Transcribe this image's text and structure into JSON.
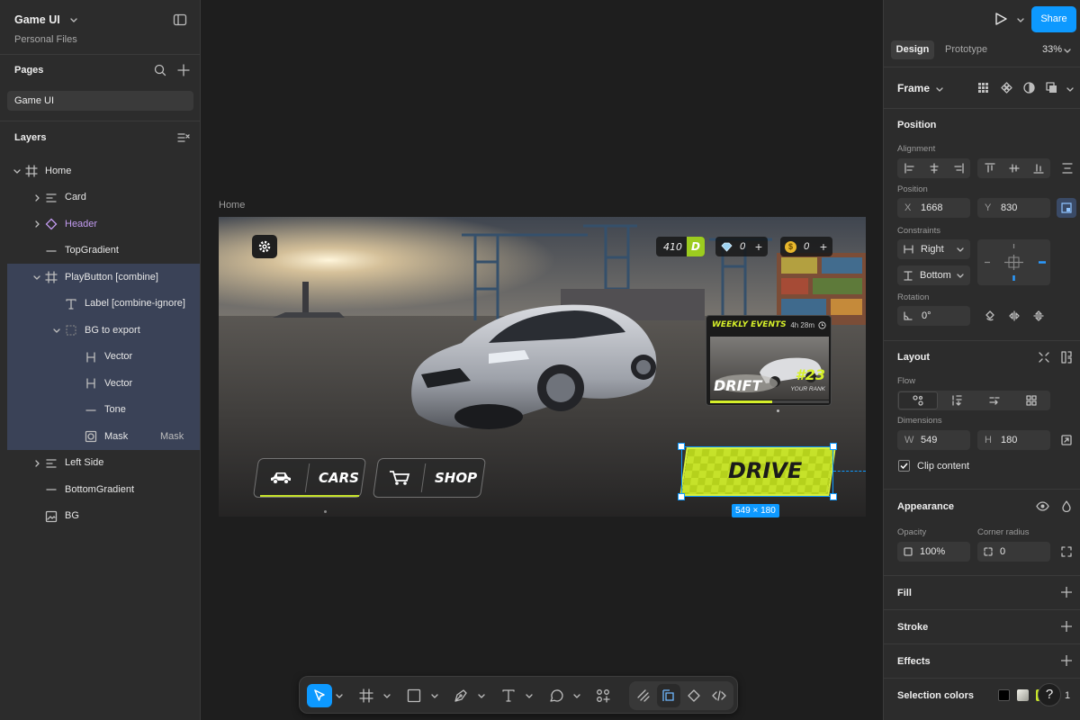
{
  "file": {
    "name": "Game UI",
    "location": "Personal Files"
  },
  "pages": {
    "title": "Pages",
    "items": [
      "Game UI"
    ]
  },
  "layers": {
    "title": "Layers",
    "items": [
      {
        "label": "Home",
        "depth": 0,
        "icon": "frame-icon"
      },
      {
        "label": "Card",
        "depth": 1,
        "icon": "auto-layout-icon"
      },
      {
        "label": "Header",
        "depth": 1,
        "icon": "component-instance-icon"
      },
      {
        "label": "TopGradient",
        "depth": 1,
        "icon": "rectangle-icon"
      },
      {
        "label": "PlayButton [combine]",
        "depth": 1,
        "icon": "frame-icon"
      },
      {
        "label": "Label [combine-ignore]",
        "depth": 2,
        "icon": "text-icon"
      },
      {
        "label": "BG to export",
        "depth": 2,
        "icon": "group-icon"
      },
      {
        "label": "Vector",
        "depth": 3,
        "icon": "vector-icon"
      },
      {
        "label": "Vector",
        "depth": 3,
        "icon": "vector-icon"
      },
      {
        "label": "Tone",
        "depth": 3,
        "icon": "rectangle-icon"
      },
      {
        "label": "Mask",
        "depth": 3,
        "icon": "mask-icon",
        "badge": "Mask"
      },
      {
        "label": "Left Side",
        "depth": 1,
        "icon": "auto-layout-icon"
      },
      {
        "label": "BottomGradient",
        "depth": 1,
        "icon": "rectangle-icon"
      },
      {
        "label": "BG",
        "depth": 1,
        "icon": "image-icon"
      }
    ]
  },
  "canvas": {
    "frame_label": "Home",
    "selection_size": "549 × 180",
    "game": {
      "trophies": "410",
      "rank_letter": "D",
      "gems": "0",
      "coins": "0",
      "event_title": "WEEKLY EVENTS",
      "event_timer": "4h 28m",
      "event_name": "DRIFT",
      "rank_number": "#23",
      "rank_caption": "YOUR RANK",
      "cars_label": "CARS",
      "shop_label": "SHOP",
      "drive_label": "DRIVE"
    }
  },
  "header_right": {
    "share": "Share"
  },
  "tabs": {
    "design": "Design",
    "prototype": "Prototype",
    "zoom": "33%"
  },
  "frame_select": "Frame",
  "position": {
    "title": "Position",
    "alignment": "Alignment",
    "position_label": "Position",
    "x_key": "X",
    "x": "1668",
    "y_key": "Y",
    "y": "830",
    "constraints": "Constraints",
    "h_constraint": "Right",
    "v_constraint": "Bottom",
    "rotation_label": "Rotation",
    "rotation": "0°"
  },
  "layout": {
    "title": "Layout",
    "flow": "Flow",
    "dimensions": "Dimensions",
    "w_key": "W",
    "w": "549",
    "h_key": "H",
    "h": "180",
    "clip": "Clip content"
  },
  "appearance": {
    "title": "Appearance",
    "opacity_label": "Opacity",
    "opacity": "100%",
    "radius_label": "Corner radius",
    "radius": "0"
  },
  "fill": "Fill",
  "stroke": "Stroke",
  "effects": "Effects",
  "selection_colors": {
    "title": "Selection colors",
    "count": "1"
  },
  "colors": {
    "accent": "#0d99ff",
    "selection_row": "#3a4257",
    "lime": "#c8e62a",
    "component": "#c29bf0"
  }
}
